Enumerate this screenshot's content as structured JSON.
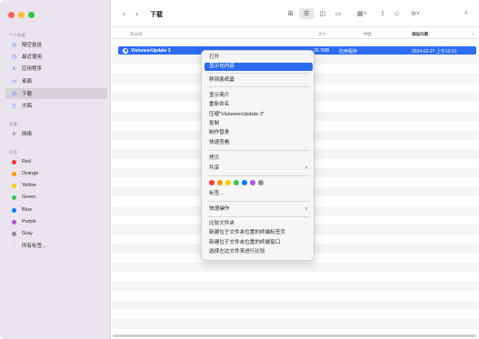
{
  "window": {
    "traffic_colors": [
      "#ff5f57",
      "#febc2e",
      "#28c840"
    ]
  },
  "sidebar": {
    "sections": [
      {
        "title": "个人收藏"
      },
      {
        "title": "位置"
      },
      {
        "title": "标签"
      }
    ],
    "favorites": [
      {
        "label": "隔空投送",
        "icon": "airdrop-icon"
      },
      {
        "label": "最近使用",
        "icon": "clock-icon"
      },
      {
        "label": "应用程序",
        "icon": "applications-icon"
      },
      {
        "label": "桌面",
        "icon": "desktop-icon"
      },
      {
        "label": "下载",
        "icon": "download-icon",
        "active": true
      },
      {
        "label": "文稿",
        "icon": "document-icon"
      }
    ],
    "locations": [
      {
        "label": "网络",
        "icon": "network-icon"
      }
    ],
    "tags": [
      {
        "label": "Red",
        "color": "#ff3b30"
      },
      {
        "label": "Orange",
        "color": "#ff9500"
      },
      {
        "label": "Yellow",
        "color": "#ffcc00"
      },
      {
        "label": "Green",
        "color": "#34c759"
      },
      {
        "label": "Blue",
        "color": "#007aff"
      },
      {
        "label": "Purple",
        "color": "#af52de"
      },
      {
        "label": "Gray",
        "color": "#8e8e93"
      },
      {
        "label": "所有标签…",
        "icon": "all-tags-icon"
      }
    ]
  },
  "toolbar": {
    "back": "‹",
    "forward": "›",
    "title": "下载"
  },
  "columns": {
    "group": "前30天",
    "size": "大小",
    "kind": "种类",
    "date_added": "添加日期"
  },
  "file": {
    "name": "VisioneerUpdate 3",
    "size": "35.7MB",
    "kind": "应用程序",
    "date": "2024-02-27 上午10:31"
  },
  "context_menu": {
    "items": [
      {
        "label": "打开"
      },
      {
        "label": "显示包内容",
        "highlighted": true
      },
      {
        "label": "移到废纸篓"
      },
      {
        "label": "显示简介"
      },
      {
        "label": "重新命名"
      },
      {
        "label": "压缩“VisioneerUpdate 3”"
      },
      {
        "label": "复制"
      },
      {
        "label": "制作替身"
      },
      {
        "label": "快速查看"
      },
      {
        "label": "拷贝"
      },
      {
        "label": "共享",
        "submenu": true
      },
      {
        "label": "标签…"
      },
      {
        "label": "快速操作",
        "submenu": true
      },
      {
        "label": "比较文件夹"
      },
      {
        "label": "新建位于文件夹位置的终端标签页"
      },
      {
        "label": "新建位于文件夹位置的终端窗口"
      },
      {
        "label": "选择左边文件来进行比较"
      }
    ],
    "tag_colors": [
      "#ff3b30",
      "#ff9500",
      "#ffcc00",
      "#34c759",
      "#007aff",
      "#af52de",
      "#8e8e93"
    ]
  },
  "colors": {
    "accent": "#2c6cf2",
    "sidebar_bg": "#eae4ee"
  }
}
